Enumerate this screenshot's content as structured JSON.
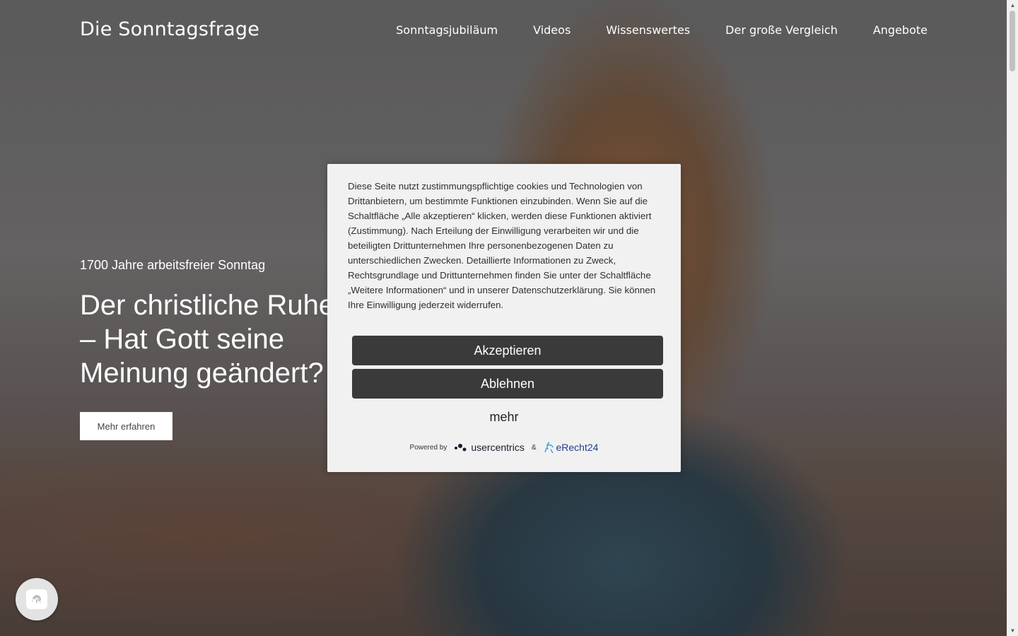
{
  "header": {
    "logo": "Die Sonntagsfrage",
    "nav": [
      {
        "label": "Sonntagsjubiläum"
      },
      {
        "label": "Videos"
      },
      {
        "label": "Wissenswertes"
      },
      {
        "label": "Der große Vergleich"
      },
      {
        "label": "Angebote"
      }
    ]
  },
  "hero": {
    "kicker": "1700 Jahre arbeitsfreier Sonntag",
    "title_line1": "Der christliche Ruhetag",
    "title_line2": "– Hat Gott seine",
    "title_line3": "Meinung geändert?",
    "button": "Mehr erfahren"
  },
  "cookie": {
    "text": "Diese Seite nutzt zustimmungspflichtige cookies und Technologien von Drittanbietern, um bestimmte Funktionen einzubinden. Wenn Sie auf die Schaltfläche „Alle akzeptieren“ klicken, werden diese Funktionen aktiviert (Zustimmung). Nach Erteilung der Einwilligung verarbeiten wir und die beteiligten Drittunternehmen Ihre personenbezogenen Daten zu unterschiedlichen Zwecken. Detaillierte Informationen zu Zweck, Rechtsgrundlage und Drittunternehmen finden Sie unter der Schaltfläche „Weitere Informationen“ und in unserer Datenschutzerklärung. Sie können Ihre Einwilligung jederzeit widerrufen.",
    "accept": "Akzeptieren",
    "deny": "Ablehnen",
    "more": "mehr",
    "powered_by": "Powered by",
    "usercentrics": "usercentrics",
    "ampersand": "&",
    "erecht": "eRecht24"
  },
  "icons": {
    "privacy_fab": "fingerprint-icon"
  },
  "colors": {
    "dialog_bg": "#f1f1f1",
    "dialog_button": "#3a3a3a",
    "erecht_blue": "#1f3f8f"
  }
}
